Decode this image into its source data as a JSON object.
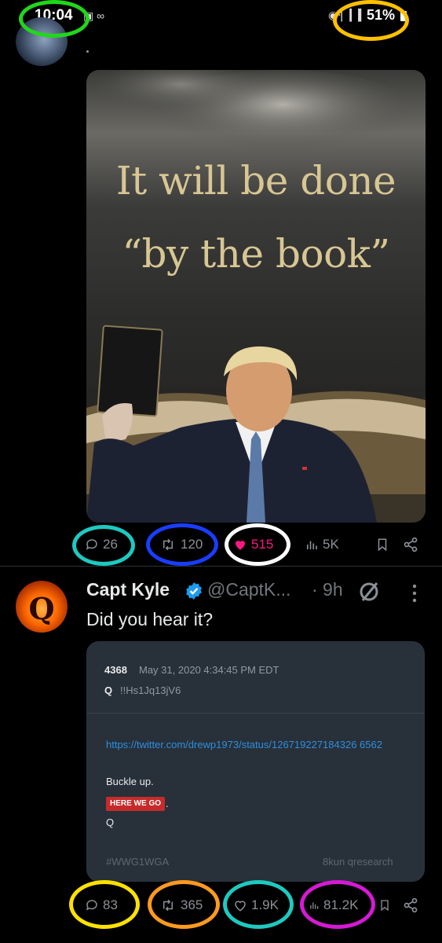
{
  "status_bar": {
    "time": "10:04",
    "left_icons": "▣ ∞",
    "signal_icons": "◉⋅▏▎▍",
    "battery": "51%"
  },
  "tweet1": {
    "image": {
      "line1": "It will be done",
      "line2": "“by the book”"
    },
    "actions": {
      "replies": "26",
      "reposts": "120",
      "likes": "515",
      "views": "5K"
    }
  },
  "tweet2": {
    "author_name": "Capt Kyle",
    "handle": "@CaptK...",
    "time": "· 9h",
    "text": "Did you hear it?",
    "quote": {
      "post_number": "4368",
      "date": "May 31, 2020 4:34:45 PM EDT",
      "name": "Q",
      "tripcode": "!!Hs1Jq13jV6",
      "link": "https://twitter.com/drewp1973/status/126719227184326 6562",
      "link_display": "https://twitter.com/drewp1973/status/1267192271843266562",
      "body": "Buckle up.",
      "tag": "HERE WE GO",
      "tag_after": ".",
      "signature": "Q",
      "footer_left": "#WWG1WGA",
      "footer_right": "8kun qresearch"
    },
    "actions": {
      "replies": "83",
      "reposts": "365",
      "likes": "1.9K",
      "views": "81.2K"
    }
  },
  "colors": {
    "background": "#000000",
    "text_primary": "#e7e9ea",
    "text_secondary": "#71767b",
    "like_active": "#f91880",
    "verified": "#1d9bf0",
    "annotation_green": "#22d61c",
    "annotation_yellow": "#ffc000",
    "annotation_cyan": "#1ec9c0",
    "annotation_blue": "#1a3dff",
    "annotation_white": "#ffffff",
    "annotation_orange": "#ff9a1f",
    "annotation_magenta": "#d41ad4"
  },
  "icons": [
    "reply-icon",
    "repost-icon",
    "like-icon",
    "views-icon",
    "bookmark-icon",
    "share-icon",
    "verified-icon",
    "grok-icon",
    "more-icon"
  ]
}
